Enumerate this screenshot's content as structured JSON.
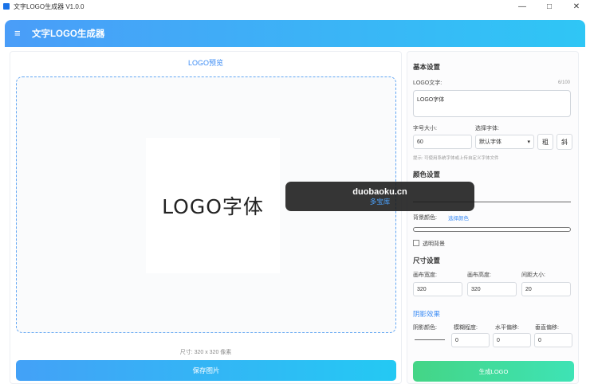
{
  "window": {
    "title": "文字LOGO生成器 V1.0.0",
    "minimize_icon": "minimize-icon",
    "maximize_icon": "maximize-icon",
    "close_icon": "close-icon"
  },
  "header": {
    "icon": "logo-app-icon",
    "title": "文字LOGO生成器"
  },
  "preview": {
    "title": "LOGO预览",
    "logo_text": "LOGO字体",
    "size_note": "尺寸: 320 x 320 像素",
    "save_button": "保存图片"
  },
  "settings": {
    "basic_title": "基本设置",
    "logo_text_label": "LOGO文字:",
    "logo_text_count": "6/100",
    "logo_text_value": "LOGO字体",
    "font_size_label": "字号大小:",
    "font_size_value": "60",
    "font_label": "选择字体:",
    "font_value": "默认字体",
    "bold_label": "粗",
    "italic_label": "斜",
    "hint": "提示: 可使用系统字体或上传自定义字体文件",
    "color_title": "颜色设置",
    "bg_color_label": "背景颜色:",
    "bg_color_link": "选择颜色",
    "transparent_label": "透明背景",
    "size_title": "尺寸设置",
    "width_label": "画布宽度:",
    "width_value": "320",
    "height_label": "画布高度:",
    "height_value": "320",
    "margin_label": "间距大小:",
    "margin_value": "20",
    "shadow_title": "阴影效果",
    "shadow_color_label": "阴影颜色:",
    "shadow_blur_label": "模糊程度:",
    "shadow_blur_value": "0",
    "shadow_x_label": "水平偏移:",
    "shadow_x_value": "0",
    "shadow_y_label": "垂直偏移:",
    "shadow_y_value": "0",
    "generate_button": "生成LOGO"
  },
  "watermark": {
    "main": "duobaoku.cn",
    "sub": "多宝库"
  },
  "colors": {
    "header_start": "#4a9df8",
    "header_end": "#2fc6f5",
    "save_button": "#43a1f7",
    "generate_button": "#44d586",
    "accent": "#3d8df5"
  }
}
